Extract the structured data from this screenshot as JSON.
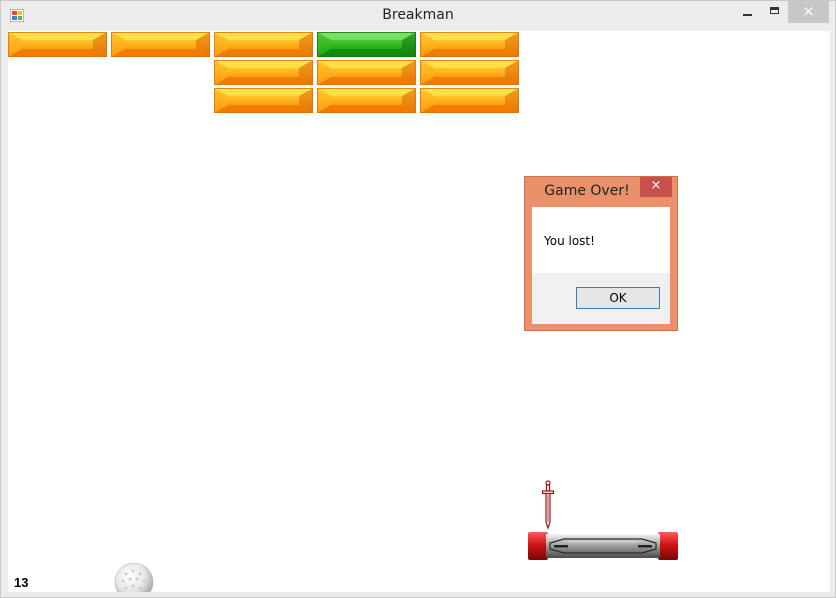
{
  "window": {
    "title": "Breakman",
    "controls": {
      "minimize": "minimize",
      "maximize": "maximize",
      "close": "×"
    }
  },
  "game": {
    "score": "13",
    "bricks": [
      {
        "row": 0,
        "col": 0,
        "color": "orange"
      },
      {
        "row": 0,
        "col": 1,
        "color": "orange"
      },
      {
        "row": 0,
        "col": 2,
        "color": "orange"
      },
      {
        "row": 0,
        "col": 3,
        "color": "green"
      },
      {
        "row": 0,
        "col": 4,
        "color": "orange"
      },
      {
        "row": 1,
        "col": 2,
        "color": "orange"
      },
      {
        "row": 1,
        "col": 3,
        "color": "orange"
      },
      {
        "row": 1,
        "col": 4,
        "color": "orange"
      },
      {
        "row": 2,
        "col": 2,
        "color": "orange"
      },
      {
        "row": 2,
        "col": 3,
        "color": "orange"
      },
      {
        "row": 2,
        "col": 4,
        "color": "orange"
      }
    ],
    "colors": {
      "orange": {
        "top": "#ffe24a",
        "mid": "#ffb21c",
        "bottom": "#f07a00",
        "edge": "#e0700a"
      },
      "green": {
        "top": "#7de06a",
        "mid": "#33bb22",
        "bottom": "#0f8a0a",
        "edge": "#127a10"
      }
    }
  },
  "dialog": {
    "title": "Game Over!",
    "close": "×",
    "message": "You lost!",
    "ok_label": "OK",
    "accent": "#e9916b"
  }
}
